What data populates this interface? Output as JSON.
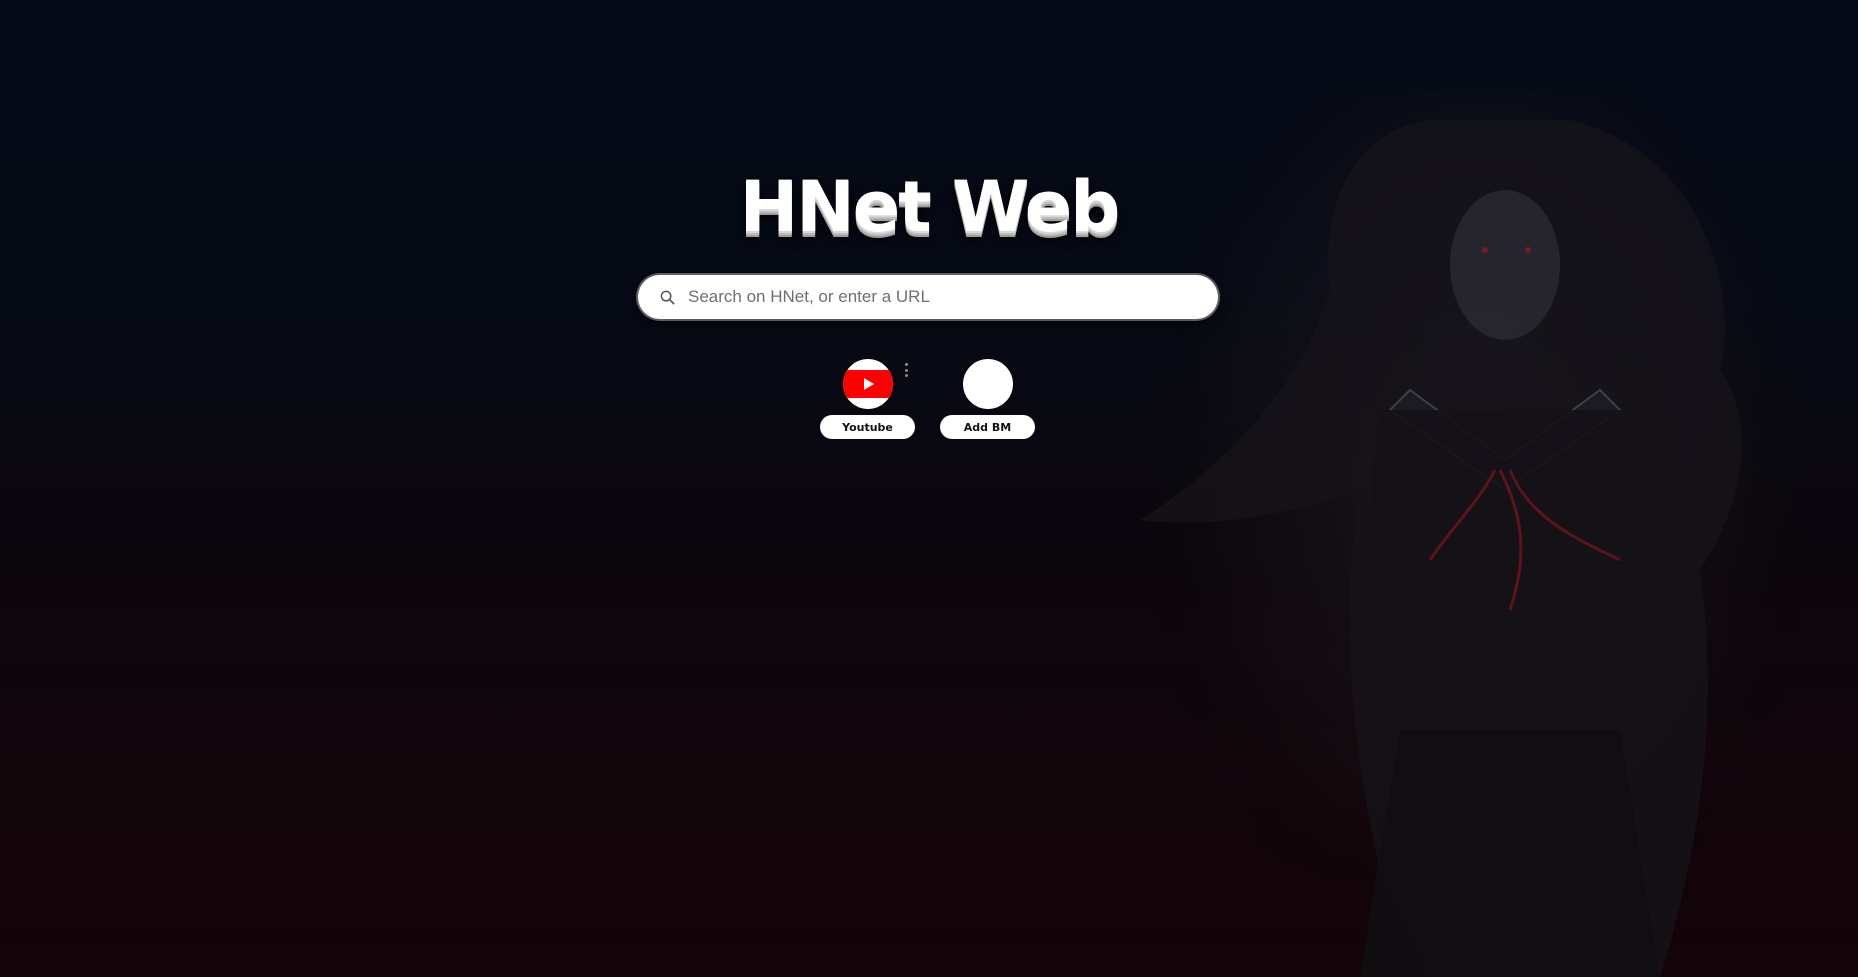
{
  "page": {
    "title": "HNet Web"
  },
  "search": {
    "placeholder": "Search on HNet, or enter a URL",
    "icon": "search-icon"
  },
  "bookmarks": [
    {
      "label": "Youtube",
      "icon": "youtube-icon",
      "color": "#ff0000"
    },
    {
      "label": "Add BM",
      "icon": "blank-circle-icon"
    }
  ],
  "colors": {
    "background_top": "#040a16",
    "background_bottom": "#140308",
    "accent": "#ff0000"
  }
}
